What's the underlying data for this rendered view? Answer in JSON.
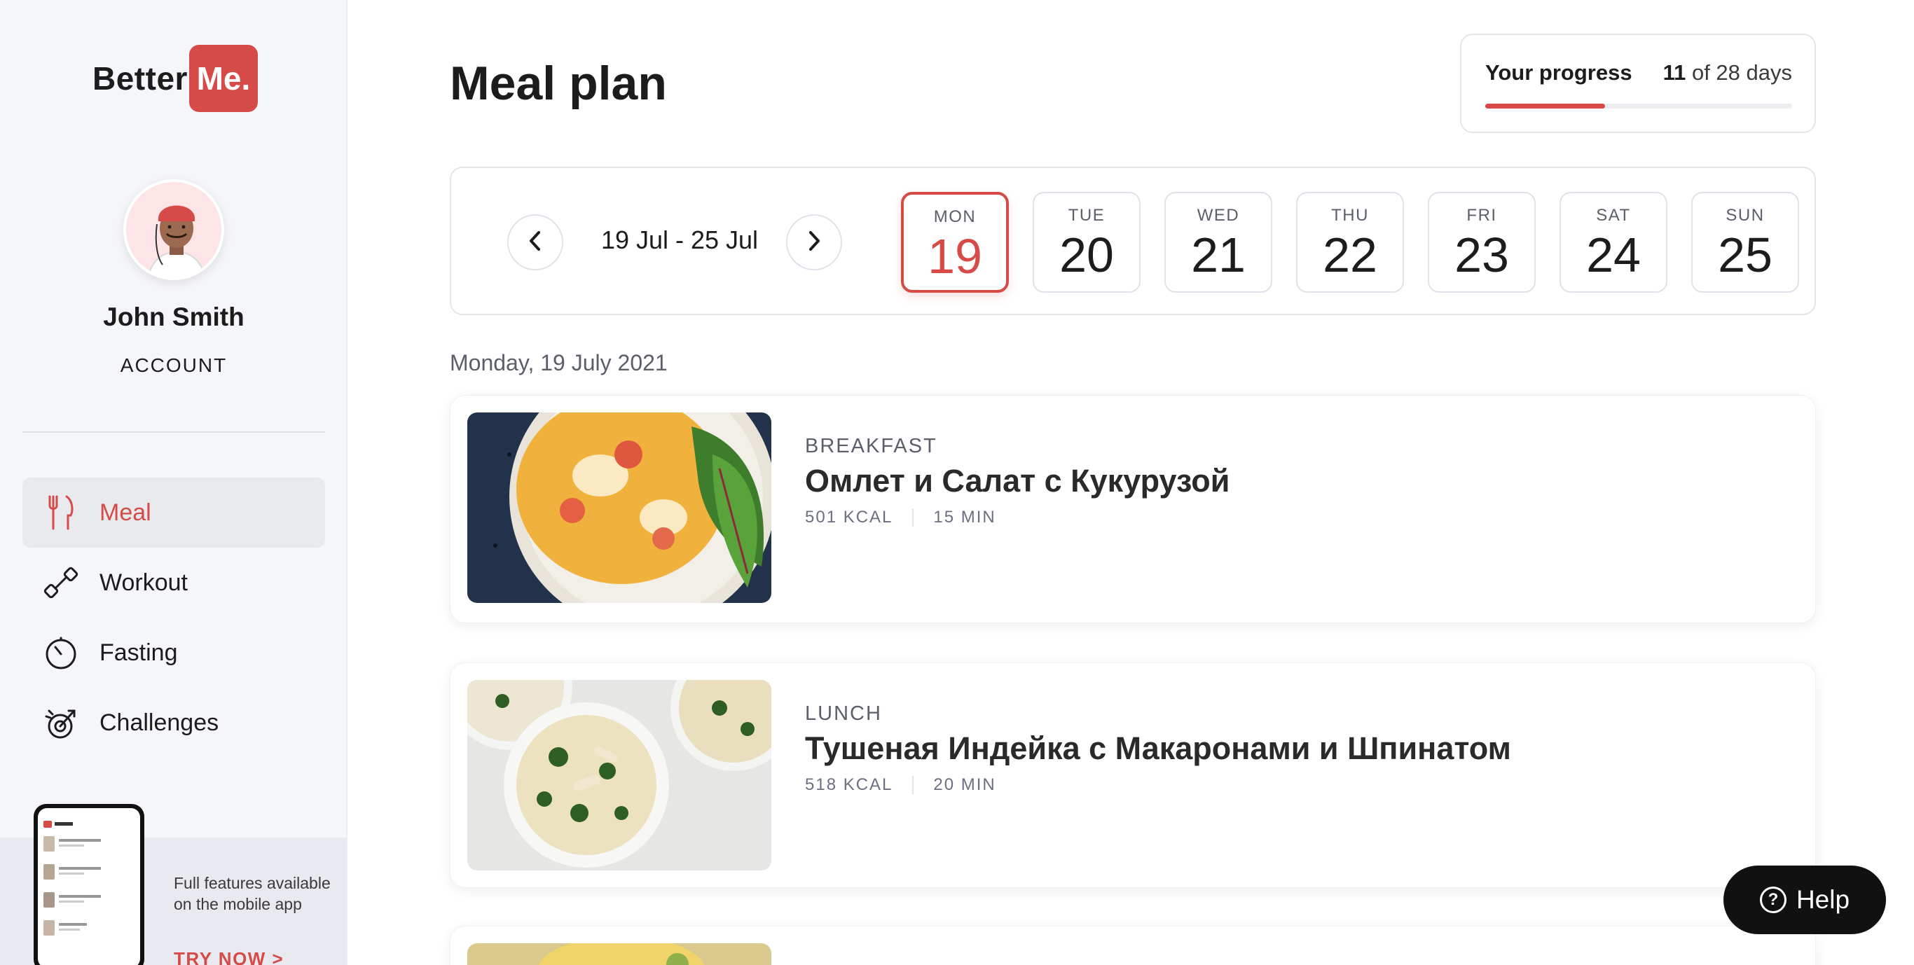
{
  "brand": {
    "name": "Better",
    "badge": "Me."
  },
  "user": {
    "name": "John Smith",
    "account_label": "ACCOUNT"
  },
  "nav": [
    {
      "label": "Meal",
      "icon": "fork-knife-icon",
      "active": true
    },
    {
      "label": "Workout",
      "icon": "dumbbell-icon",
      "active": false
    },
    {
      "label": "Fasting",
      "icon": "timer-icon",
      "active": false
    },
    {
      "label": "Challenges",
      "icon": "target-icon",
      "active": false
    }
  ],
  "promo": {
    "text": "Full features available on the mobile app",
    "cta": "TRY NOW >"
  },
  "page": {
    "title": "Meal plan"
  },
  "progress": {
    "label": "Your progress",
    "current": "11",
    "rest": " of 28 days",
    "fraction": 0.39
  },
  "week": {
    "range": "19 Jul - 25 Jul",
    "days": [
      {
        "name": "MON",
        "num": "19",
        "active": true
      },
      {
        "name": "TUE",
        "num": "20",
        "active": false
      },
      {
        "name": "WED",
        "num": "21",
        "active": false
      },
      {
        "name": "THU",
        "num": "22",
        "active": false
      },
      {
        "name": "FRI",
        "num": "23",
        "active": false
      },
      {
        "name": "SAT",
        "num": "24",
        "active": false
      },
      {
        "name": "SUN",
        "num": "25",
        "active": false
      }
    ]
  },
  "date_heading": "Monday, 19 July 2021",
  "meals": [
    {
      "type": "BREAKFAST",
      "title": "Омлет и Салат с Кукурузой",
      "kcal": "501 KCAL",
      "time": "15 MIN"
    },
    {
      "type": "LUNCH",
      "title": "Тушеная Индейка с Макаронами и Шпинатом",
      "kcal": "518 KCAL",
      "time": "20 MIN"
    }
  ],
  "help": {
    "label": "Help"
  },
  "colors": {
    "accent": "#d64b47",
    "sidebar_bg": "#f5f6f9",
    "help_bg": "#111111"
  }
}
